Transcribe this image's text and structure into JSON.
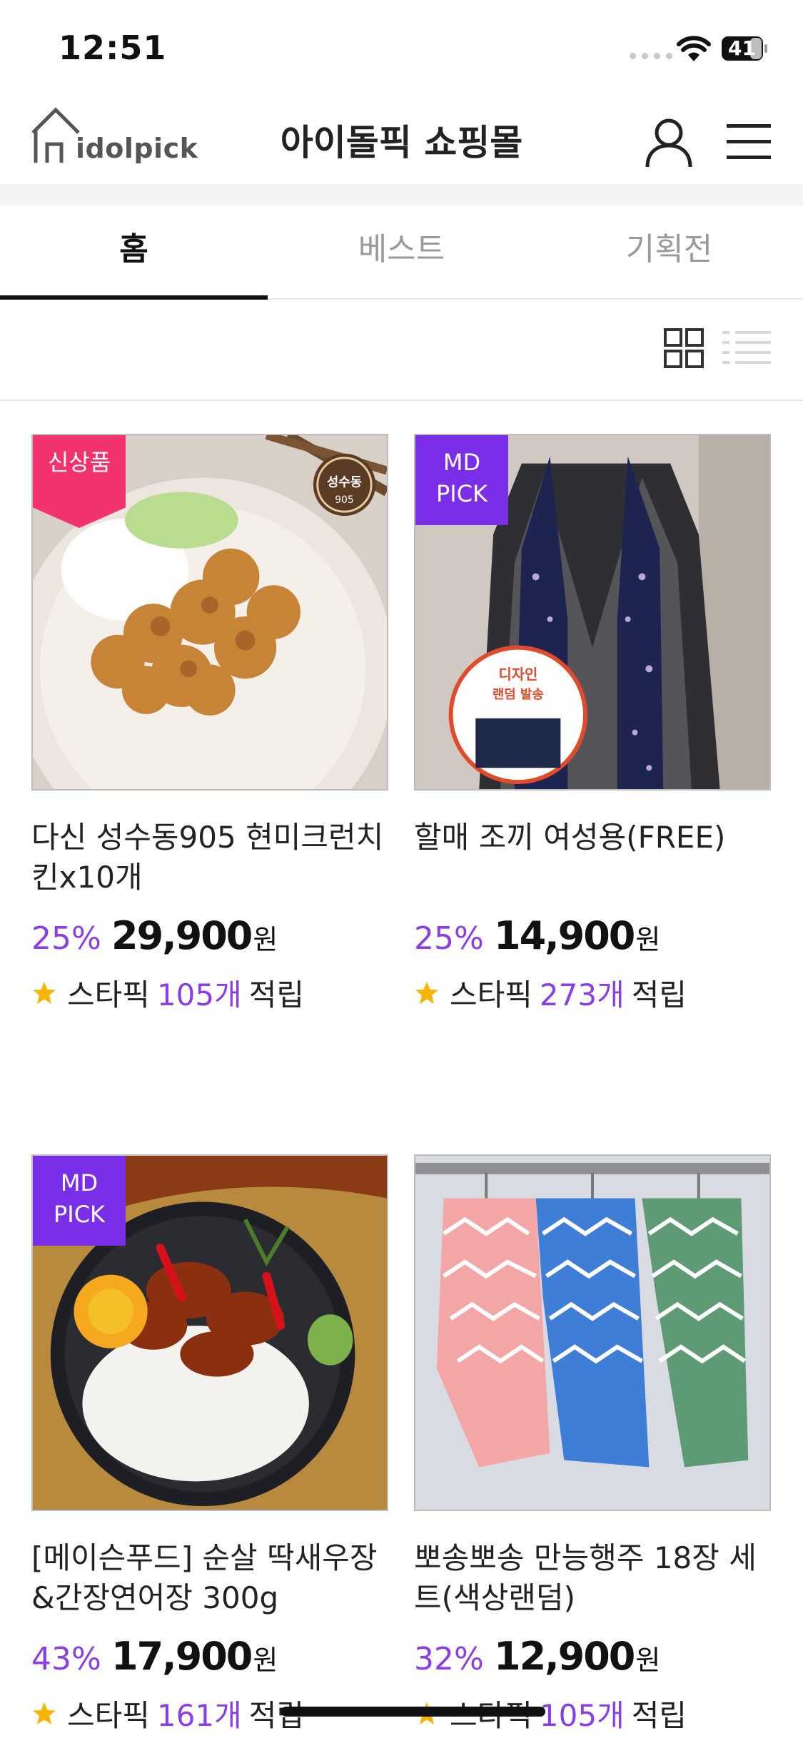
{
  "status_bar": {
    "time": "12:51",
    "battery": "41"
  },
  "header": {
    "logo_text": "idolpick",
    "title": "아이돌픽 쇼핑몰"
  },
  "tabs": [
    {
      "label": "홈",
      "active": true
    },
    {
      "label": "베스트",
      "active": false
    },
    {
      "label": "기획전",
      "active": false
    }
  ],
  "view_toggle": {
    "selected": "grid"
  },
  "products": [
    {
      "badge": "신상품",
      "name_line1": "다신 성수동905 현미크런치",
      "name_line2": "킨x10개",
      "discount": "25%",
      "price": "29,900",
      "currency": "원",
      "point_label": "스타픽",
      "point_count": "105개",
      "point_suffix": "적립",
      "image_text_1": "성수동",
      "image_text_2": "905"
    },
    {
      "badge_line1": "MD",
      "badge_line2": "PICK",
      "name_line1": "할매 조끼 여성용(FREE)",
      "name_line2": "",
      "discount": "25%",
      "price": "14,900",
      "currency": "원",
      "point_label": "스타픽",
      "point_count": "273개",
      "point_suffix": "적립",
      "image_text_1": "디자인",
      "image_text_2": "랜덤 발송"
    },
    {
      "badge_line1": "MD",
      "badge_line2": "PICK",
      "name_line1": "[메이슨푸드] 순살 딱새우장",
      "name_line2": "&간장연어장 300g",
      "discount": "43%",
      "price": "17,900",
      "currency": "원",
      "point_label": "스타픽",
      "point_count": "161개",
      "point_suffix": "적립"
    },
    {
      "name_line1": "뽀송뽀송 만능행주 18장 세",
      "name_line2": "트(색상랜덤)",
      "discount": "32%",
      "price": "12,900",
      "currency": "원",
      "point_label": "스타픽",
      "point_count": "105개",
      "point_suffix": "적립"
    }
  ],
  "colors": {
    "accent": "#8a3fe6",
    "new_badge": "#f2336d",
    "md_badge": "#7a2ee8",
    "star": "#f7b500"
  }
}
